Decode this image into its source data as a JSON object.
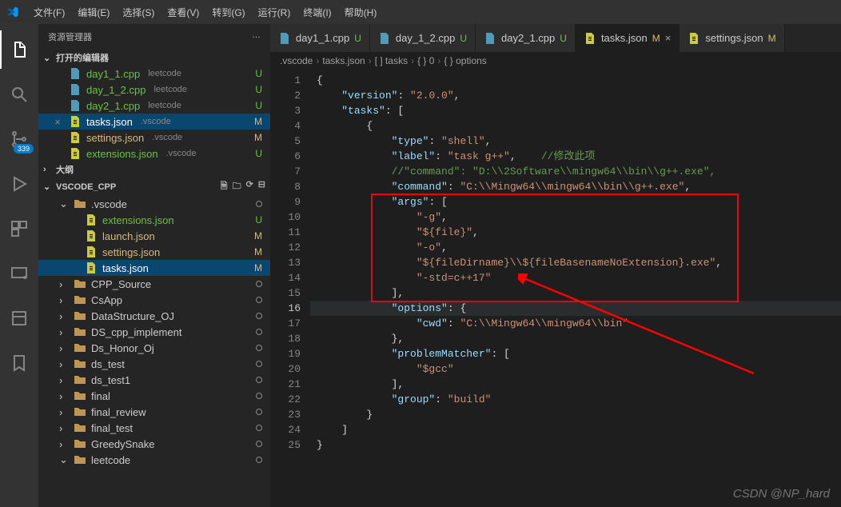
{
  "menubar": {
    "items": [
      "文件(F)",
      "编辑(E)",
      "选择(S)",
      "查看(V)",
      "转到(G)",
      "运行(R)",
      "终端(I)",
      "帮助(H)"
    ]
  },
  "activitybar": {
    "badge": "339"
  },
  "sidebar": {
    "title": "资源管理器",
    "more": "…",
    "open_editors_label": "打开的编辑器",
    "outline_label": "大纲",
    "open_editors": [
      {
        "name": "day1_1.cpp",
        "meta": "leetcode",
        "status": "U"
      },
      {
        "name": "day_1_2.cpp",
        "meta": "leetcode",
        "status": "U"
      },
      {
        "name": "day2_1.cpp",
        "meta": "leetcode",
        "status": "U"
      },
      {
        "name": "tasks.json",
        "meta": ".vscode",
        "status": "M",
        "active": true
      },
      {
        "name": "settings.json",
        "meta": ".vscode",
        "status": "M"
      },
      {
        "name": "extensions.json",
        "meta": ".vscode",
        "status": "U"
      }
    ],
    "folder_name": "VSCODE_CPP",
    "tree": [
      {
        "depth": 1,
        "type": "folder",
        "name": ".vscode",
        "open": true,
        "dot": true
      },
      {
        "depth": 2,
        "type": "file",
        "name": "extensions.json",
        "status": "U"
      },
      {
        "depth": 2,
        "type": "file",
        "name": "launch.json",
        "status": "M"
      },
      {
        "depth": 2,
        "type": "file",
        "name": "settings.json",
        "status": "M"
      },
      {
        "depth": 2,
        "type": "file",
        "name": "tasks.json",
        "status": "M",
        "active": true
      },
      {
        "depth": 1,
        "type": "folder",
        "name": "CPP_Source",
        "dot": true
      },
      {
        "depth": 1,
        "type": "folder",
        "name": "CsApp",
        "dot": true
      },
      {
        "depth": 1,
        "type": "folder",
        "name": "DataStructure_OJ",
        "dot": true
      },
      {
        "depth": 1,
        "type": "folder",
        "name": "DS_cpp_implement",
        "dot": true
      },
      {
        "depth": 1,
        "type": "folder",
        "name": "Ds_Honor_Oj",
        "dot": true
      },
      {
        "depth": 1,
        "type": "folder",
        "name": "ds_test",
        "dot": true
      },
      {
        "depth": 1,
        "type": "folder",
        "name": "ds_test1",
        "dot": true
      },
      {
        "depth": 1,
        "type": "folder",
        "name": "final",
        "dot": true
      },
      {
        "depth": 1,
        "type": "folder",
        "name": "final_review",
        "dot": true
      },
      {
        "depth": 1,
        "type": "folder",
        "name": "final_test",
        "dot": true
      },
      {
        "depth": 1,
        "type": "folder",
        "name": "GreedySnake",
        "dot": true
      },
      {
        "depth": 1,
        "type": "folder",
        "name": "leetcode",
        "open": true,
        "dot": true
      }
    ]
  },
  "tabs": [
    {
      "name": "day1_1.cpp",
      "status": "U",
      "icon": "cpp"
    },
    {
      "name": "day_1_2.cpp",
      "status": "U",
      "icon": "cpp"
    },
    {
      "name": "day2_1.cpp",
      "status": "U",
      "icon": "cpp"
    },
    {
      "name": "tasks.json",
      "status": "M",
      "icon": "json",
      "active": true,
      "close": true
    },
    {
      "name": "settings.json",
      "status": "M",
      "icon": "json"
    }
  ],
  "breadcrumb": [
    ".vscode",
    "tasks.json",
    "[ ] tasks",
    "{ } 0",
    "{ } options"
  ],
  "code": {
    "lines": [
      {
        "n": 1,
        "tokens": [
          [
            "pun",
            "{"
          ]
        ]
      },
      {
        "n": 2,
        "tokens": [
          [
            "pun",
            "    "
          ],
          [
            "key",
            "\"version\""
          ],
          [
            "pun",
            ": "
          ],
          [
            "str",
            "\"2.0.0\""
          ],
          [
            "pun",
            ","
          ]
        ]
      },
      {
        "n": 3,
        "tokens": [
          [
            "pun",
            "    "
          ],
          [
            "key",
            "\"tasks\""
          ],
          [
            "pun",
            ": ["
          ]
        ]
      },
      {
        "n": 4,
        "tokens": [
          [
            "pun",
            "        {"
          ]
        ]
      },
      {
        "n": 5,
        "tokens": [
          [
            "pun",
            "            "
          ],
          [
            "key",
            "\"type\""
          ],
          [
            "pun",
            ": "
          ],
          [
            "str",
            "\"shell\""
          ],
          [
            "pun",
            ","
          ]
        ]
      },
      {
        "n": 6,
        "tokens": [
          [
            "pun",
            "            "
          ],
          [
            "key",
            "\"label\""
          ],
          [
            "pun",
            ": "
          ],
          [
            "str",
            "\"task g++\""
          ],
          [
            "pun",
            ",    "
          ],
          [
            "com",
            "//修改此项"
          ]
        ]
      },
      {
        "n": 7,
        "tokens": [
          [
            "pun",
            "            "
          ],
          [
            "com",
            "//\"command\": \"D:\\\\2Software\\\\mingw64\\\\bin\\\\g++.exe\","
          ]
        ]
      },
      {
        "n": 8,
        "tokens": [
          [
            "pun",
            "            "
          ],
          [
            "key",
            "\"command\""
          ],
          [
            "pun",
            ": "
          ],
          [
            "str",
            "\"C:\\\\Mingw64\\\\mingw64\\\\bin\\\\g++.exe\""
          ],
          [
            "pun",
            ","
          ]
        ]
      },
      {
        "n": 9,
        "tokens": [
          [
            "pun",
            "            "
          ],
          [
            "key",
            "\"args\""
          ],
          [
            "pun",
            ": ["
          ]
        ]
      },
      {
        "n": 10,
        "tokens": [
          [
            "pun",
            "                "
          ],
          [
            "str",
            "\"-g\""
          ],
          [
            "pun",
            ","
          ]
        ]
      },
      {
        "n": 11,
        "tokens": [
          [
            "pun",
            "                "
          ],
          [
            "str",
            "\"${file}\""
          ],
          [
            "pun",
            ","
          ]
        ]
      },
      {
        "n": 12,
        "tokens": [
          [
            "pun",
            "                "
          ],
          [
            "str",
            "\"-o\""
          ],
          [
            "pun",
            ","
          ]
        ]
      },
      {
        "n": 13,
        "tokens": [
          [
            "pun",
            "                "
          ],
          [
            "str",
            "\"${fileDirname}\\\\${fileBasenameNoExtension}.exe\""
          ],
          [
            "pun",
            ","
          ]
        ]
      },
      {
        "n": 14,
        "tokens": [
          [
            "pun",
            "                "
          ],
          [
            "str",
            "\"-std=c++17\""
          ]
        ]
      },
      {
        "n": 15,
        "tokens": [
          [
            "pun",
            "            ],"
          ]
        ]
      },
      {
        "n": 16,
        "tokens": [
          [
            "pun",
            "            "
          ],
          [
            "key",
            "\"options\""
          ],
          [
            "pun",
            ": {"
          ]
        ],
        "hl": true
      },
      {
        "n": 17,
        "tokens": [
          [
            "pun",
            "                "
          ],
          [
            "key",
            "\"cwd\""
          ],
          [
            "pun",
            ": "
          ],
          [
            "str",
            "\"C:\\\\Mingw64\\\\mingw64\\\\bin\""
          ]
        ]
      },
      {
        "n": 18,
        "tokens": [
          [
            "pun",
            "            },"
          ]
        ]
      },
      {
        "n": 19,
        "tokens": [
          [
            "pun",
            "            "
          ],
          [
            "key",
            "\"problemMatcher\""
          ],
          [
            "pun",
            ": ["
          ]
        ]
      },
      {
        "n": 20,
        "tokens": [
          [
            "pun",
            "                "
          ],
          [
            "str",
            "\"$gcc\""
          ]
        ]
      },
      {
        "n": 21,
        "tokens": [
          [
            "pun",
            "            ],"
          ]
        ]
      },
      {
        "n": 22,
        "tokens": [
          [
            "pun",
            "            "
          ],
          [
            "key",
            "\"group\""
          ],
          [
            "pun",
            ": "
          ],
          [
            "str",
            "\"build\""
          ]
        ]
      },
      {
        "n": 23,
        "tokens": [
          [
            "pun",
            "        }"
          ]
        ]
      },
      {
        "n": 24,
        "tokens": [
          [
            "pun",
            "    ]"
          ]
        ]
      },
      {
        "n": 25,
        "tokens": [
          [
            "pun",
            "}"
          ]
        ]
      }
    ]
  },
  "watermark": "CSDN @NP_hard"
}
